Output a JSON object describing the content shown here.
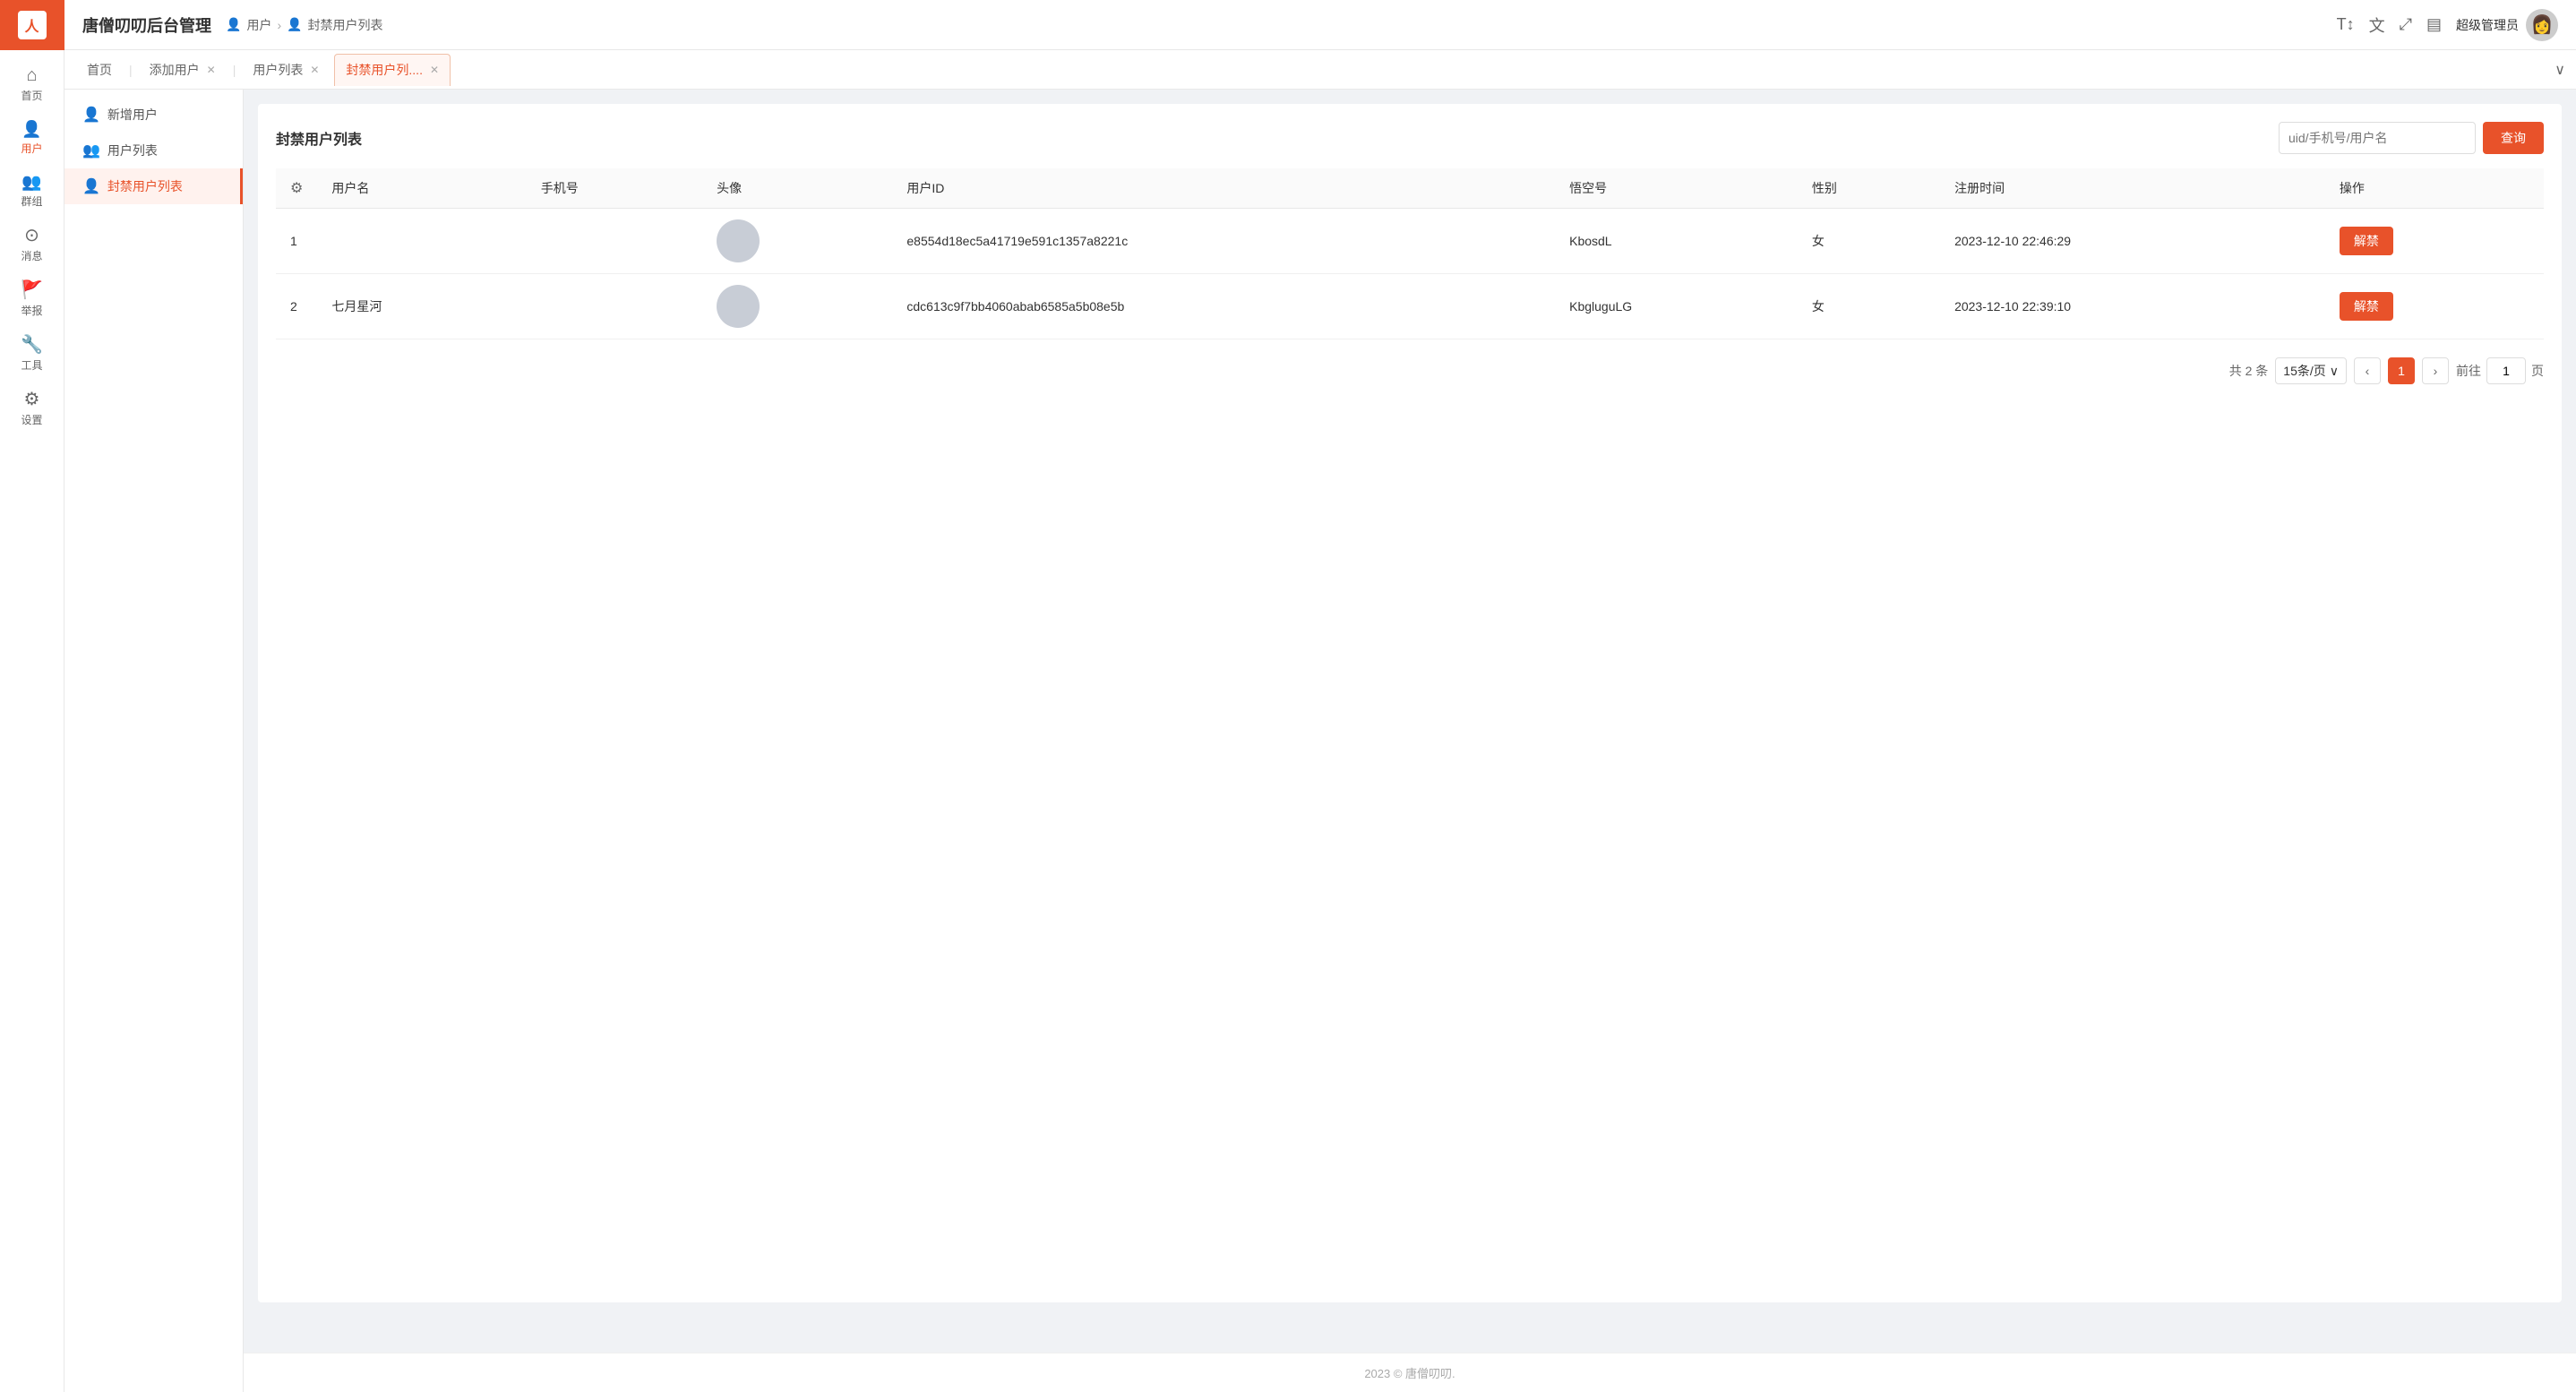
{
  "app": {
    "title": "唐僧叨叨后台管理",
    "logo_text": "人"
  },
  "breadcrumb": {
    "items": [
      "用户",
      "封禁用户列表"
    ]
  },
  "header": {
    "icons": [
      "font-size",
      "translate",
      "fullscreen",
      "layout"
    ],
    "username": "超级管理员"
  },
  "tabs": [
    {
      "label": "首页",
      "closable": false,
      "active": false
    },
    {
      "label": "添加用户",
      "closable": true,
      "active": false
    },
    {
      "label": "用户列表",
      "closable": true,
      "active": false
    },
    {
      "label": "封禁用户列....",
      "closable": true,
      "active": true
    }
  ],
  "sidebar": {
    "items": [
      {
        "icon": "⊞",
        "label": "首页",
        "active": false
      },
      {
        "icon": "👤",
        "label": "用户",
        "active": true
      },
      {
        "icon": "👥",
        "label": "群组",
        "active": false
      },
      {
        "icon": "💬",
        "label": "消息",
        "active": false
      },
      {
        "icon": "🚩",
        "label": "举报",
        "active": false
      },
      {
        "icon": "🔧",
        "label": "工具",
        "active": false
      },
      {
        "icon": "⚙",
        "label": "设置",
        "active": false
      }
    ]
  },
  "sub_sidebar": {
    "items": [
      {
        "icon": "👤",
        "label": "新增用户",
        "active": false
      },
      {
        "icon": "👥",
        "label": "用户列表",
        "active": false
      },
      {
        "icon": "🚫",
        "label": "封禁用户列表",
        "active": true
      }
    ]
  },
  "page": {
    "title": "封禁用户列表",
    "search_placeholder": "uid/手机号/用户名",
    "search_btn": "查询"
  },
  "table": {
    "columns": [
      "#",
      "用户名",
      "手机号",
      "头像",
      "用户ID",
      "悟空号",
      "性别",
      "注册时间",
      "操作"
    ],
    "rows": [
      {
        "index": "1",
        "username": "",
        "phone": "",
        "avatar": "",
        "user_id": "e8554d18ec5a41719e591c1357a8221c",
        "wukong_id": "KbosdL",
        "gender": "女",
        "reg_time": "2023-12-10 22:46:29",
        "action": "解禁"
      },
      {
        "index": "2",
        "username": "七月星河",
        "phone": "",
        "avatar": "",
        "user_id": "cdc613c9f7bb4060abab6585a5b08e5b",
        "wukong_id": "KbgluguLG",
        "gender": "女",
        "reg_time": "2023-12-10 22:39:10",
        "action": "解禁"
      }
    ]
  },
  "pagination": {
    "total_text": "共 2 条",
    "page_size": "15条/页",
    "prev_btn": "‹",
    "next_btn": "›",
    "current_page": "1",
    "goto_label": "前往",
    "goto_unit": "页"
  },
  "footer": {
    "text": "2023 © 唐僧叨叨."
  }
}
